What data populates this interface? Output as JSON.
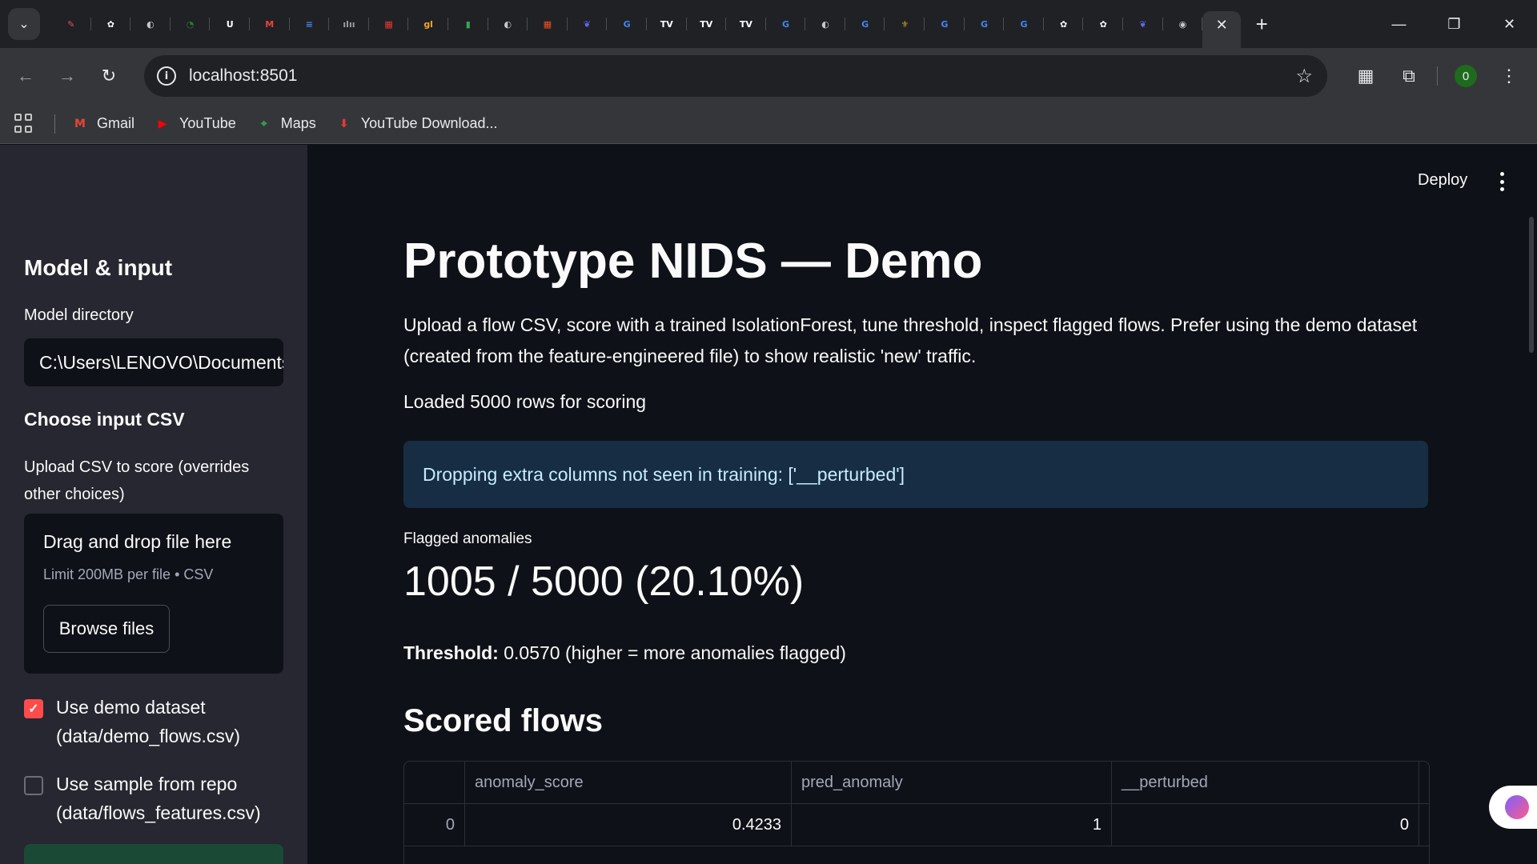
{
  "browser": {
    "tabs": [
      {
        "icon": "pencil-app-icon",
        "color": "#e84a6b",
        "glyph": "✎"
      },
      {
        "icon": "openai-icon",
        "color": "#ffffff",
        "glyph": "✿"
      },
      {
        "icon": "globe-icon",
        "color": "#c4c7c5",
        "glyph": "◐"
      },
      {
        "icon": "tradingview-green-icon",
        "color": "#2e7d32",
        "glyph": "◔"
      },
      {
        "icon": "upwork-icon",
        "color": "#ffffff",
        "glyph": "U"
      },
      {
        "icon": "gmail-icon",
        "color": "#ea4335",
        "glyph": "M"
      },
      {
        "icon": "google-docs-icon",
        "color": "#4285f4",
        "glyph": "≡"
      },
      {
        "icon": "cisco-icon",
        "color": "#9aa0a6",
        "glyph": "ılıı"
      },
      {
        "icon": "cisco-red-icon",
        "color": "#e53935",
        "glyph": "▦"
      },
      {
        "icon": "gl-icon",
        "color": "#f5a623",
        "glyph": "gl"
      },
      {
        "icon": "bar-chart-icon",
        "color": "#34a853",
        "glyph": "▮"
      },
      {
        "icon": "globe-icon",
        "color": "#c4c7c5",
        "glyph": "◐"
      },
      {
        "icon": "microsoft-icon",
        "color": "#f25022",
        "glyph": "▦"
      },
      {
        "icon": "bird-icon",
        "color": "#5b6cff",
        "glyph": "❦"
      },
      {
        "icon": "google-icon",
        "color": "#4285f4",
        "glyph": "G"
      },
      {
        "icon": "tradingview-icon",
        "color": "#ffffff",
        "glyph": "TV"
      },
      {
        "icon": "tradingview-icon",
        "color": "#ffffff",
        "glyph": "TV"
      },
      {
        "icon": "tradingview-icon",
        "color": "#ffffff",
        "glyph": "TV"
      },
      {
        "icon": "google-icon",
        "color": "#4285f4",
        "glyph": "G"
      },
      {
        "icon": "globe-icon",
        "color": "#c4c7c5",
        "glyph": "◐"
      },
      {
        "icon": "google-icon",
        "color": "#4285f4",
        "glyph": "G"
      },
      {
        "icon": "university-icon",
        "color": "#c9a227",
        "glyph": "⚜"
      },
      {
        "icon": "google-icon",
        "color": "#4285f4",
        "glyph": "G"
      },
      {
        "icon": "google-icon",
        "color": "#4285f4",
        "glyph": "G"
      },
      {
        "icon": "google-icon",
        "color": "#4285f4",
        "glyph": "G"
      },
      {
        "icon": "openai-icon",
        "color": "#ffffff",
        "glyph": "✿"
      },
      {
        "icon": "openai-icon",
        "color": "#ffffff",
        "glyph": "✿"
      },
      {
        "icon": "bird-icon",
        "color": "#5b6cff",
        "glyph": "❦"
      },
      {
        "icon": "chrome-icon",
        "color": "#c4c7c5",
        "glyph": "◉"
      }
    ],
    "url": "localhost:8501",
    "profile_initial": "0",
    "bookmarks": [
      {
        "label": "Gmail",
        "icon": "gmail-icon",
        "color": "#ea4335",
        "glyph": "M"
      },
      {
        "label": "YouTube",
        "icon": "youtube-icon",
        "color": "#ff0000",
        "glyph": "▶"
      },
      {
        "label": "Maps",
        "icon": "maps-icon",
        "color": "#34a853",
        "glyph": "⌖"
      },
      {
        "label": "YouTube Download...",
        "icon": "download-icon",
        "color": "#e53935",
        "glyph": "⬇"
      }
    ]
  },
  "sidebar": {
    "heading": "Model & input",
    "model_dir_label": "Model directory",
    "model_dir_value": "C:\\Users\\LENOVO\\Documents",
    "choose_heading": "Choose input CSV",
    "upload_label": "Upload CSV to score (overrides other choices)",
    "dropzone_title": "Drag and drop file here",
    "dropzone_limit": "Limit 200MB per file • CSV",
    "browse_label": "Browse files",
    "demo_checkbox": {
      "label": "Use demo dataset (data/demo_flows.csv)",
      "checked": true
    },
    "sample_checkbox": {
      "label": "Use sample from repo (data/flows_features.csv)",
      "checked": false
    }
  },
  "main": {
    "deploy_label": "Deploy",
    "title": "Prototype NIDS — Demo",
    "intro": "Upload a flow CSV, score with a trained IsolationForest, tune threshold, inspect flagged flows. Prefer using the demo dataset (created from the feature-engineered file) to show realistic 'new' traffic.",
    "loaded": "Loaded 5000 rows for scoring",
    "info_message": "Dropping extra columns not seen in training: ['__perturbed']",
    "metric_label": "Flagged anomalies",
    "metric_value": "1005 / 5000 (20.10%)",
    "threshold_label": "Threshold:",
    "threshold_text": "0.0570 (higher = more anomalies flagged)",
    "section_heading": "Scored flows",
    "table": {
      "columns": [
        "",
        "anomaly_score",
        "pred_anomaly",
        "__perturbed"
      ],
      "rows": [
        [
          "0",
          "0.4233",
          "1",
          "0"
        ]
      ]
    }
  },
  "colors": {
    "accent": "#ff4b4b",
    "info_bg": "#172d43",
    "info_text": "#c7ebff",
    "background": "#0e1117",
    "sidebar_bg": "#262730"
  }
}
